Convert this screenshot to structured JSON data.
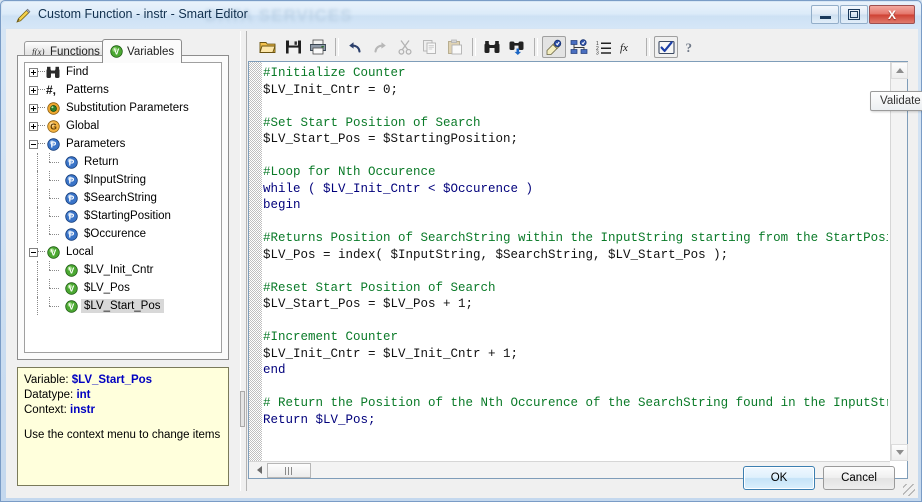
{
  "window": {
    "title": "Custom Function - instr - Smart Editor",
    "watermark": "DATA SERVICES",
    "icon": "pencil-icon",
    "buttons": {
      "minimize": "–",
      "maximize": "□",
      "close": "X"
    }
  },
  "tabs": [
    {
      "label": "Functions",
      "icon": "fx-icon",
      "active": false
    },
    {
      "label": "Variables",
      "icon": "variable-green-icon",
      "active": true
    }
  ],
  "tree": [
    {
      "label": "Find",
      "icon": "binoculars-icon",
      "level": 0,
      "expander": "plus",
      "selected": false
    },
    {
      "label": "Patterns",
      "icon": "hash-icon",
      "level": 0,
      "expander": "plus",
      "selected": false
    },
    {
      "label": "Substitution Parameters",
      "icon": "substitution-icon",
      "level": 0,
      "expander": "plus",
      "selected": false
    },
    {
      "label": "Global",
      "icon": "global-g-icon",
      "level": 0,
      "expander": "plus",
      "selected": false
    },
    {
      "label": "Parameters",
      "icon": "parameter-p-icon",
      "level": 0,
      "expander": "minus",
      "selected": false
    },
    {
      "label": "Return",
      "icon": "parameter-p-icon",
      "level": 1,
      "expander": "none",
      "selected": false
    },
    {
      "label": "$InputString",
      "icon": "parameter-p-icon",
      "level": 1,
      "expander": "none",
      "selected": false
    },
    {
      "label": "$SearchString",
      "icon": "parameter-p-icon",
      "level": 1,
      "expander": "none",
      "selected": false
    },
    {
      "label": "$StartingPosition",
      "icon": "parameter-p-icon",
      "level": 1,
      "expander": "none",
      "selected": false
    },
    {
      "label": "$Occurence",
      "icon": "parameter-p-icon",
      "level": 1,
      "expander": "none",
      "selected": false
    },
    {
      "label": "Local",
      "icon": "variable-green-icon",
      "level": 0,
      "expander": "minus",
      "selected": false
    },
    {
      "label": "$LV_Init_Cntr",
      "icon": "variable-green-icon",
      "level": 1,
      "expander": "none",
      "selected": false
    },
    {
      "label": "$LV_Pos",
      "icon": "variable-green-icon",
      "level": 1,
      "expander": "none",
      "selected": false
    },
    {
      "label": "$LV_Start_Pos",
      "icon": "variable-green-icon",
      "level": 1,
      "expander": "none",
      "selected": true
    }
  ],
  "info": {
    "variable_label": "Variable:",
    "variable_value": "$LV_Start_Pos",
    "datatype_label": "Datatype:",
    "datatype_value": "int",
    "context_label": "Context:",
    "context_value": "instr",
    "hint": "Use the context menu to change items"
  },
  "toolbar": [
    {
      "name": "open-icon",
      "title": "Open",
      "state": "normal"
    },
    {
      "name": "save-icon",
      "title": "Save",
      "state": "normal"
    },
    {
      "name": "print-icon",
      "title": "Print",
      "state": "normal"
    },
    {
      "name": "separator",
      "title": "",
      "state": "sep"
    },
    {
      "name": "undo-icon",
      "title": "Undo",
      "state": "normal"
    },
    {
      "name": "redo-icon",
      "title": "Redo",
      "state": "disabled"
    },
    {
      "name": "cut-icon",
      "title": "Cut",
      "state": "disabled"
    },
    {
      "name": "copy-icon",
      "title": "Copy",
      "state": "disabled"
    },
    {
      "name": "paste-icon",
      "title": "Paste",
      "state": "disabled"
    },
    {
      "name": "separator",
      "title": "",
      "state": "sep"
    },
    {
      "name": "find-icon",
      "title": "Find",
      "state": "normal"
    },
    {
      "name": "find-replace-icon",
      "title": "Find and Replace",
      "state": "normal"
    },
    {
      "name": "separator",
      "title": "",
      "state": "sep"
    },
    {
      "name": "smart-editor-icon",
      "title": "Smart Editor",
      "state": "pressed"
    },
    {
      "name": "variables-tree-icon",
      "title": "Variables",
      "state": "normal"
    },
    {
      "name": "list-icon",
      "title": "List",
      "state": "normal"
    },
    {
      "name": "fx-italic-icon",
      "title": "Functions",
      "state": "normal"
    },
    {
      "name": "separator",
      "title": "",
      "state": "sep"
    },
    {
      "name": "validate-icon",
      "title": "Validate",
      "state": "framed"
    },
    {
      "name": "help-icon",
      "title": "Help",
      "state": "normal"
    }
  ],
  "tooltip": {
    "text": "Validate"
  },
  "code_lines": [
    {
      "text": "#Initialize Counter",
      "type": "comment"
    },
    {
      "text": "$LV_Init_Cntr = 0;",
      "type": "code"
    },
    {
      "text": "",
      "type": "blank"
    },
    {
      "text": "#Set Start Position of Search",
      "type": "comment"
    },
    {
      "text": "$LV_Start_Pos = $StartingPosition;",
      "type": "code"
    },
    {
      "text": "",
      "type": "blank"
    },
    {
      "text": "#Loop for Nth Occurence",
      "type": "comment"
    },
    {
      "text": "while ( $LV_Init_Cntr < $Occurence )",
      "type": "keyword"
    },
    {
      "text": "begin",
      "type": "keyword"
    },
    {
      "text": "",
      "type": "blank"
    },
    {
      "text": "#Returns Position of SearchString within the InputString starting from the StartPosition",
      "type": "comment"
    },
    {
      "text": "$LV_Pos = index( $InputString, $SearchString, $LV_Start_Pos );",
      "type": "code"
    },
    {
      "text": "",
      "type": "blank"
    },
    {
      "text": "#Reset Start Position of Search",
      "type": "comment"
    },
    {
      "text": "$LV_Start_Pos = $LV_Pos + 1;",
      "type": "code"
    },
    {
      "text": "",
      "type": "blank"
    },
    {
      "text": "#Increment Counter",
      "type": "comment"
    },
    {
      "text": "$LV_Init_Cntr = $LV_Init_Cntr + 1;",
      "type": "code"
    },
    {
      "text": "end",
      "type": "keyword"
    },
    {
      "text": "",
      "type": "blank"
    },
    {
      "text": "# Return the Position of the Nth Occurence of the SearchString found in the InputString",
      "type": "comment"
    },
    {
      "text": "Return $LV_Pos;",
      "type": "keyword"
    }
  ],
  "footer": {
    "ok_label": "OK",
    "cancel_label": "Cancel"
  },
  "colors": {
    "comment": "#0a7a28",
    "keyword": "#00007b",
    "code": "#101010",
    "selection": "#d8d8d8",
    "info_bg": "#ffffdc",
    "accent": "#3c7fb1"
  }
}
